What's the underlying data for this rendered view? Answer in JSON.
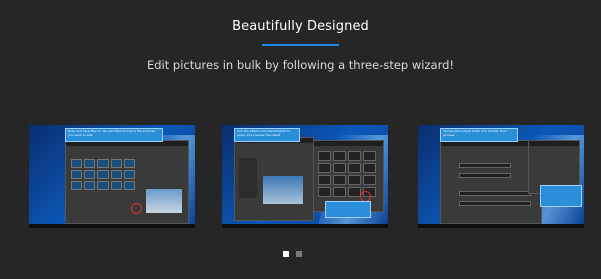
{
  "heading": "Beautifully Designed",
  "subheading": "Edit pictures in bulk by following a three-step wizard!",
  "accent_color": "#1e88e5",
  "screenshots": [
    {
      "callout_text": "Drag and drop files or use Add Files to import the pictures you want to edit"
    },
    {
      "callout_text": "Pick the effects and adjustments to apply and preview the result"
    },
    {
      "callout_text": "Choose the output folder and format, then process"
    }
  ],
  "carousel": {
    "pages": 2,
    "active_page": 1,
    "active_color": "#ffffff",
    "inactive_color": "#7a7a7a"
  }
}
